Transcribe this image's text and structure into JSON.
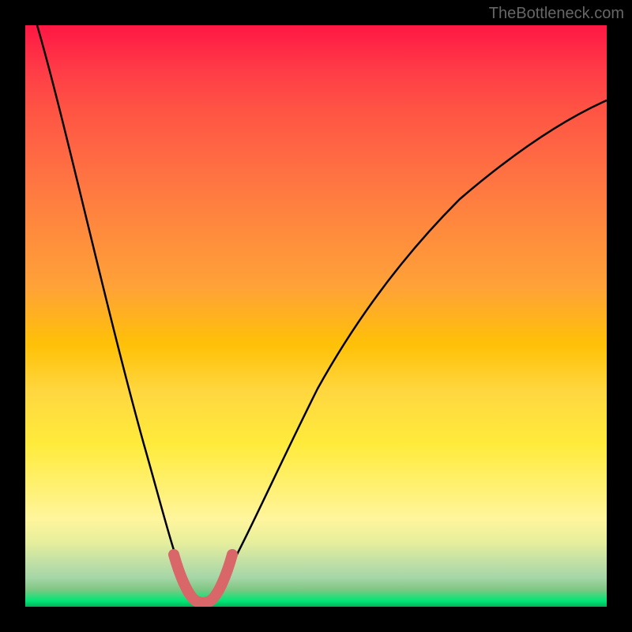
{
  "watermark": "TheBottleneck.com",
  "chart_data": {
    "type": "line",
    "title": "",
    "xlabel": "",
    "ylabel": "",
    "xlim": [
      0,
      100
    ],
    "ylim": [
      0,
      100
    ],
    "series": [
      {
        "name": "bottleneck-curve",
        "x": [
          2,
          5,
          8,
          11,
          14,
          17,
          20,
          22,
          24,
          26,
          28,
          30,
          32,
          34,
          38,
          42,
          46,
          50,
          55,
          60,
          65,
          70,
          75,
          80,
          85,
          90,
          95,
          100
        ],
        "y": [
          100,
          88,
          76,
          64,
          52,
          40,
          28,
          18,
          10,
          5,
          2,
          2,
          5,
          10,
          20,
          30,
          40,
          48,
          56,
          63,
          69,
          74,
          78,
          82,
          85,
          88,
          90,
          92
        ]
      },
      {
        "name": "highlight-segment",
        "x": [
          22,
          24,
          26,
          28,
          30,
          32,
          34
        ],
        "y": [
          18,
          10,
          5,
          2,
          2,
          5,
          10
        ]
      }
    ],
    "gradient_stops": [
      {
        "pos": 0,
        "color": "#ff1744"
      },
      {
        "pos": 50,
        "color": "#ffc107"
      },
      {
        "pos": 80,
        "color": "#ffeb3b"
      },
      {
        "pos": 100,
        "color": "#00b359"
      }
    ]
  }
}
